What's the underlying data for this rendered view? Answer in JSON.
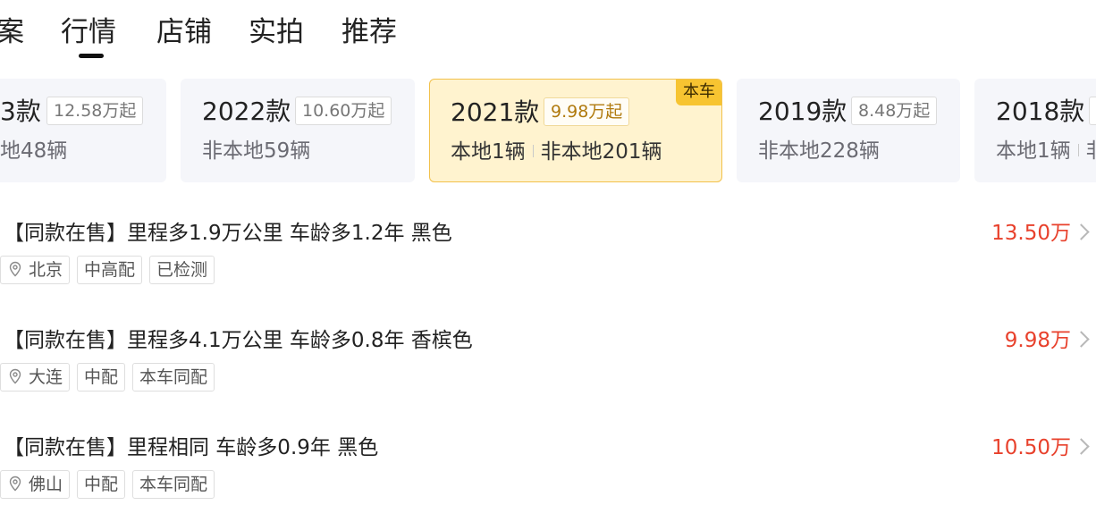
{
  "tabs": [
    {
      "label": "案"
    },
    {
      "label": "行情",
      "active": true
    },
    {
      "label": "店铺"
    },
    {
      "label": "实拍"
    },
    {
      "label": "推荐"
    }
  ],
  "year_cards": [
    {
      "year": "3款",
      "price": "12.58万起",
      "local": "地48辆",
      "non_local": ""
    },
    {
      "year": "2022款",
      "price": "10.60万起",
      "local": "",
      "non_local": "非本地59辆"
    },
    {
      "year": "2021款",
      "price": "9.98万起",
      "local": "本地1辆",
      "non_local": "非本地201辆",
      "badge": "本车",
      "active": true
    },
    {
      "year": "2019款",
      "price": "8.48万起",
      "local": "",
      "non_local": "非本地228辆"
    },
    {
      "year": "2018款",
      "price": "",
      "local": "本地1辆",
      "non_local": "非"
    }
  ],
  "listings": [
    {
      "title": "【同款在售】里程多1.9万公里 车龄多1.2年 黑色",
      "price": "13.50万",
      "city": "北京",
      "tags": [
        "中高配",
        "已检测"
      ]
    },
    {
      "title": "【同款在售】里程多4.1万公里 车龄多0.8年 香槟色",
      "price": "9.98万",
      "city": "大连",
      "tags": [
        "中配",
        "本车同配"
      ]
    },
    {
      "title": "【同款在售】里程相同 车龄多0.9年 黑色",
      "price": "10.50万",
      "city": "佛山",
      "tags": [
        "中配",
        "本车同配"
      ]
    }
  ],
  "colors": {
    "accent_price": "#e8412c",
    "active_card_bg": "#fff3cf",
    "badge_bg": "#f7c431"
  },
  "icons": {
    "location": "location-pin-icon",
    "chevron": "chevron-right-icon"
  }
}
